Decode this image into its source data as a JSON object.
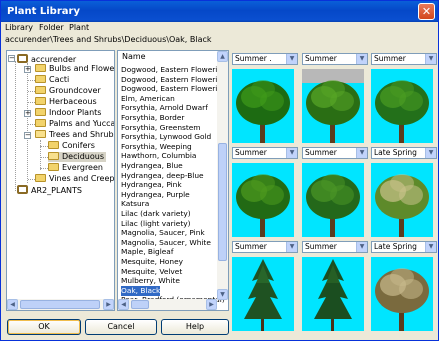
{
  "window": {
    "title": "Plant Library",
    "close_glyph": "✕"
  },
  "menu": [
    "Library",
    "Folder",
    "Plant"
  ],
  "path": "accurender\\Trees and Shrubs\\Deciduous\\Oak, Black",
  "tree": {
    "root": "accurender",
    "items": [
      {
        "label": "Bulbs and Flowers",
        "expandable": true
      },
      {
        "label": "Cacti",
        "expandable": false
      },
      {
        "label": "Groundcover",
        "expandable": false
      },
      {
        "label": "Herbaceous",
        "expandable": false
      },
      {
        "label": "Indoor Plants",
        "expandable": true
      },
      {
        "label": "Palms and Yuccas",
        "expandable": false
      },
      {
        "label": "Trees and Shrubs",
        "expandable": true,
        "expanded": true
      },
      {
        "label": "Conifers",
        "child": true
      },
      {
        "label": "Deciduous",
        "child": true,
        "selected": true
      },
      {
        "label": "Evergreen",
        "child": true
      },
      {
        "label": "Vines and Creepers",
        "expandable": false
      }
    ],
    "root2": "AR2_PLANTS"
  },
  "list": {
    "header": "Name",
    "items": [
      "Dogwood, Eastern Flowering,",
      "Dogwood, Eastern Flowering,",
      "Dogwood, Eastern Flowering,",
      "Elm, American",
      "Forsythia, Arnold Dwarf",
      "Forsythia, Border",
      "Forsythia, Greenstem",
      "Forsythia, Lynwood Gold",
      "Forsythia, Weeping",
      "Hawthorn, Columbia",
      "Hydrangea, Blue",
      "Hydrangea, deep-Blue",
      "Hydrangea, Pink",
      "Hydrangea, Purple",
      "Katsura",
      "Lilac (dark variety)",
      "Lilac (light variety)",
      "Magnolia, Saucer, Pink",
      "Magnolia, Saucer, White",
      "Maple, Bigleaf",
      "Mesquite, Honey",
      "Mesquite, Velvet",
      "Mulberry, White",
      "Oak, Black",
      "Pear, Bradford (ornamental)"
    ],
    "selected": "Oak, Black"
  },
  "buttons": {
    "ok": "OK",
    "cancel": "Cancel",
    "help": "Help"
  },
  "previews": [
    {
      "season": "Summer ."
    },
    {
      "season": "Summer"
    },
    {
      "season": "Summer"
    },
    {
      "season": "Summer"
    },
    {
      "season": "Summer"
    },
    {
      "season": "Late Spring"
    },
    {
      "season": "Summer"
    },
    {
      "season": "Summer"
    },
    {
      "season": "Late Spring"
    }
  ],
  "colors": {
    "title_bar": "#0a4fd0",
    "selection": "#316ac5",
    "preview_bg": "#00e5ff"
  }
}
